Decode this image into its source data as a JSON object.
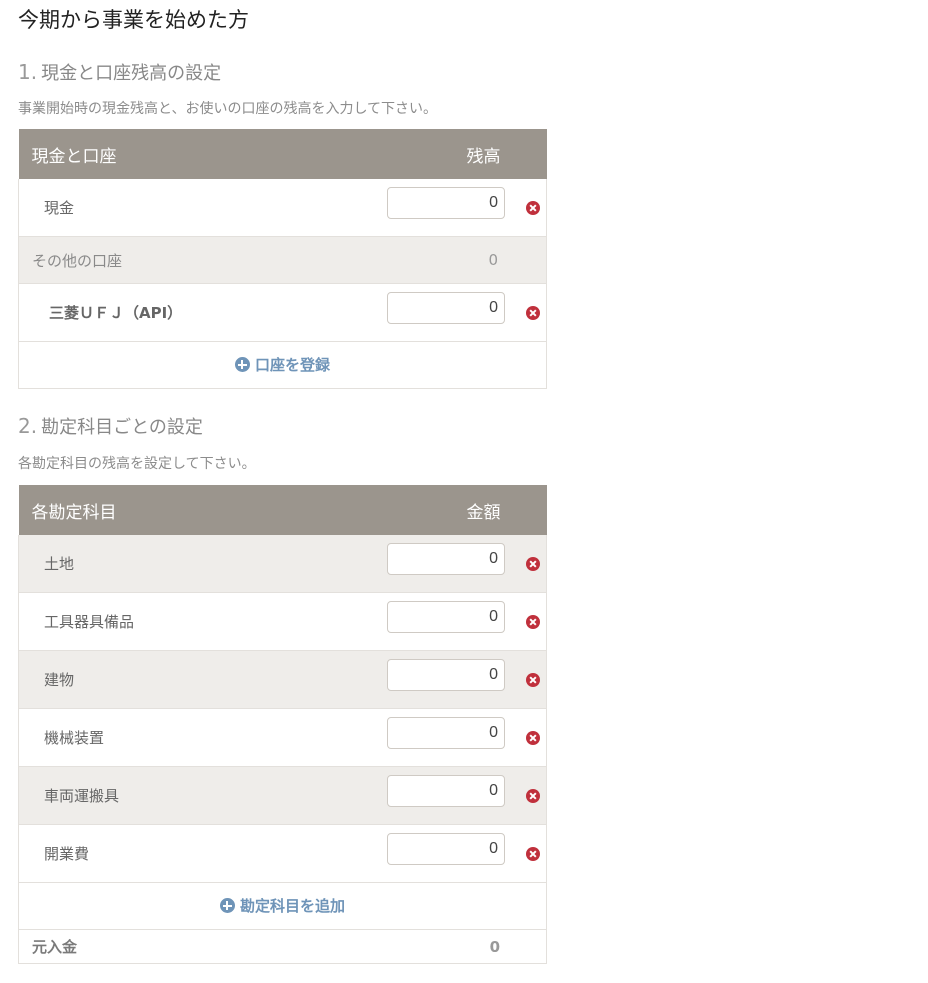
{
  "page": {
    "title": "今期から事業を始めた方"
  },
  "section1": {
    "number": "1.",
    "title": "現金と口座残高の設定",
    "description": "事業開始時の現金残高と、お使いの口座の残高を入力して下さい。",
    "table": {
      "header_name": "現金と口座",
      "header_amount": "残高"
    },
    "cash": {
      "label": "現金",
      "value": "0"
    },
    "other_accounts": {
      "label": "その他の口座",
      "value": "0"
    },
    "bank": {
      "label": "三菱ＵＦＪ（API）",
      "value": "0"
    },
    "add_account_label": "口座を登録"
  },
  "section2": {
    "number": "2.",
    "title": "勘定科目ごとの設定",
    "description": "各勘定科目の残高を設定して下さい。",
    "table": {
      "header_name": "各勘定科目",
      "header_amount": "金額"
    },
    "items": [
      {
        "label": "土地",
        "value": "0"
      },
      {
        "label": "工具器具備品",
        "value": "0"
      },
      {
        "label": "建物",
        "value": "0"
      },
      {
        "label": "機械装置",
        "value": "0"
      },
      {
        "label": "車両運搬具",
        "value": "0"
      },
      {
        "label": "開業費",
        "value": "0"
      }
    ],
    "add_item_label": "勘定科目を追加",
    "total": {
      "label": "元入金",
      "value": "0"
    }
  },
  "colors": {
    "table_header": "#9b958d",
    "shaded_row": "#efedea",
    "link": "#6f94b8",
    "remove": "#c0303c"
  }
}
